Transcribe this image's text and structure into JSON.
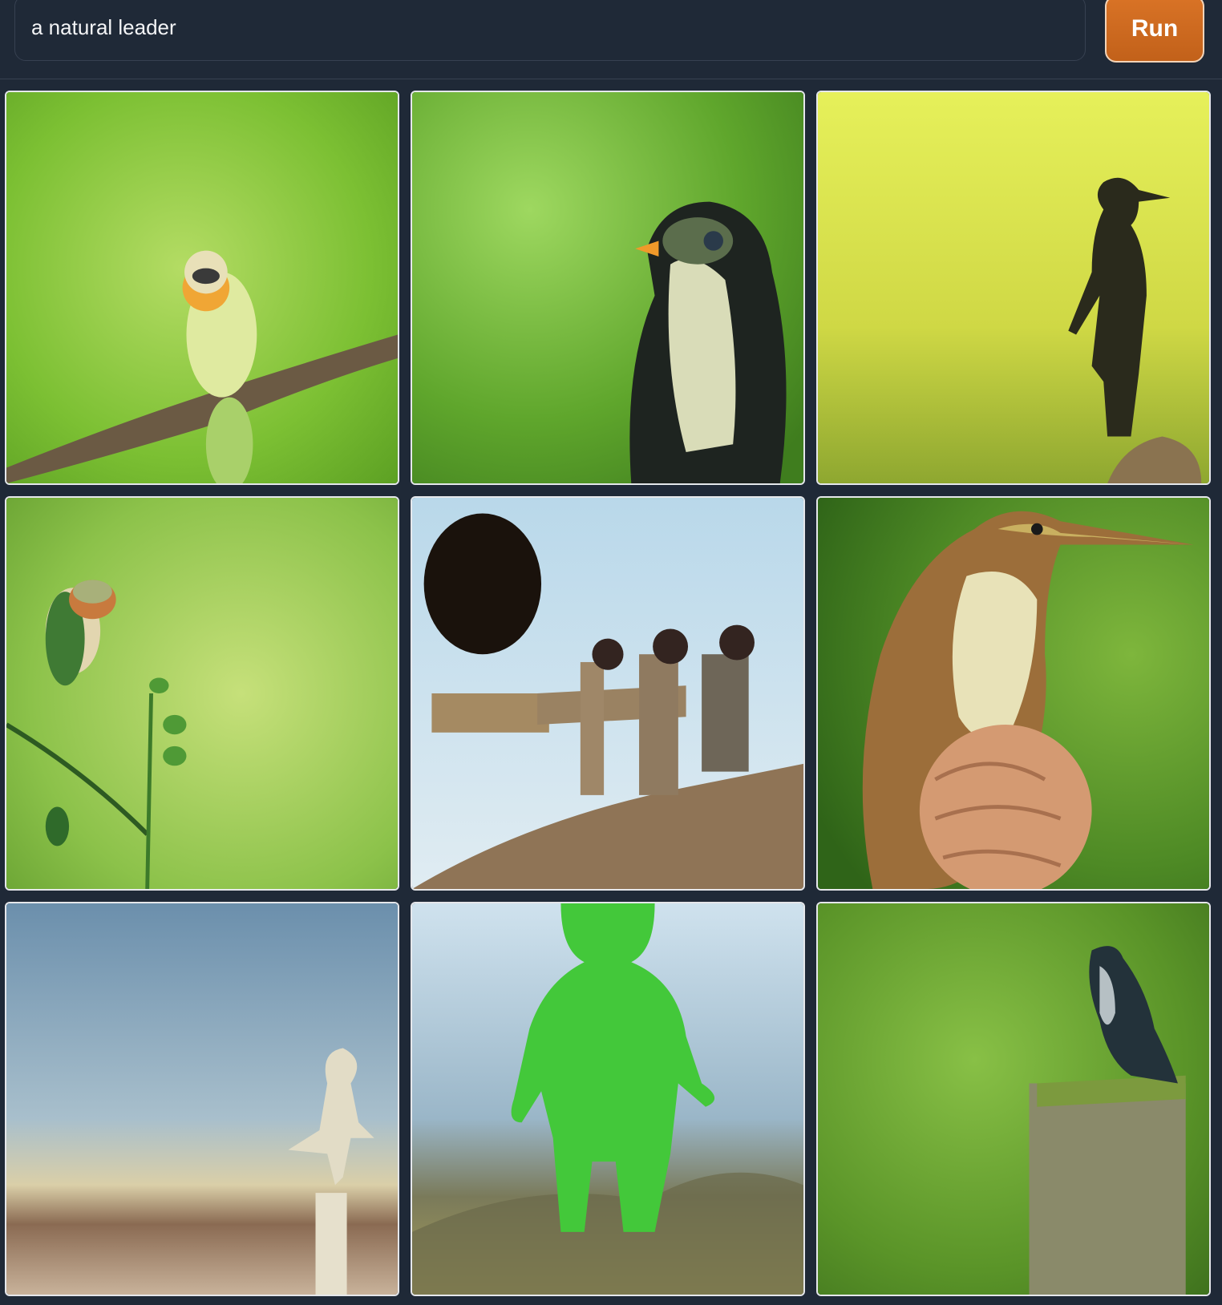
{
  "prompt": {
    "value": "a natural leader"
  },
  "run_button": {
    "label": "Run",
    "color": "#cc6a22"
  },
  "gallery": {
    "images": [
      {
        "subject": "small yellow-green bird on a branch"
      },
      {
        "subject": "dark bird with orange beak on blurred green"
      },
      {
        "subject": "bird-headed silhouette figure on yellow-green"
      },
      {
        "subject": "small bird perched on a green sprout"
      },
      {
        "subject": "black bird and small figures on a rock"
      },
      {
        "subject": "long-beaked bird held in a hand"
      },
      {
        "subject": "small white statue figure under blue sky"
      },
      {
        "subject": "green clay figure on blurred landscape"
      },
      {
        "subject": "small bird perched on a wooden post"
      }
    ]
  }
}
